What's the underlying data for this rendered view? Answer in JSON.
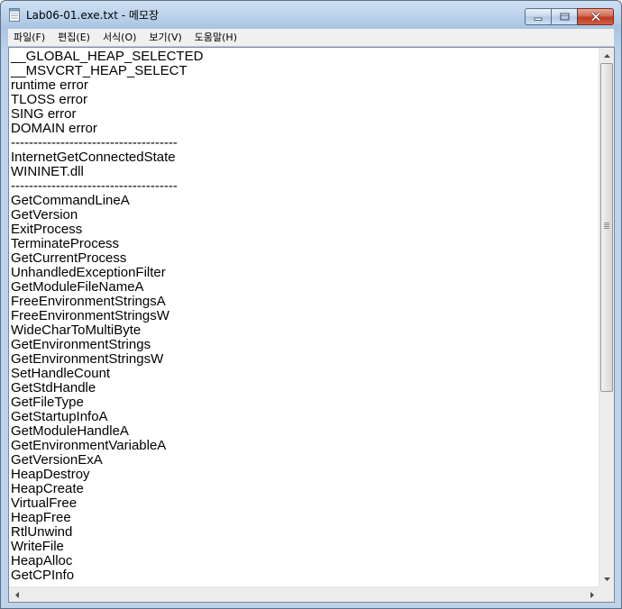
{
  "window": {
    "title": "Lab06-01.exe.txt - 메모장",
    "minimize_icon": "minimize-icon",
    "maximize_icon": "maximize-icon",
    "close_icon": "close-icon",
    "app_icon": "notepad-icon"
  },
  "menu": [
    {
      "label": "파일(F)"
    },
    {
      "label": "편집(E)"
    },
    {
      "label": "서식(O)"
    },
    {
      "label": "보기(V)"
    },
    {
      "label": "도움말(H)"
    }
  ],
  "content": {
    "lines": [
      "__GLOBAL_HEAP_SELECTED",
      "__MSVCRT_HEAP_SELECT",
      "runtime error",
      "TLOSS error",
      "SING error",
      "DOMAIN error",
      "-------------------------------------",
      "InternetGetConnectedState",
      "WININET.dll",
      "-------------------------------------",
      "GetCommandLineA",
      "GetVersion",
      "ExitProcess",
      "TerminateProcess",
      "GetCurrentProcess",
      "UnhandledExceptionFilter",
      "GetModuleFileNameA",
      "FreeEnvironmentStringsA",
      "FreeEnvironmentStringsW",
      "WideCharToMultiByte",
      "GetEnvironmentStrings",
      "GetEnvironmentStringsW",
      "SetHandleCount",
      "GetStdHandle",
      "GetFileType",
      "GetStartupInfoA",
      "GetModuleHandleA",
      "GetEnvironmentVariableA",
      "GetVersionExA",
      "HeapDestroy",
      "HeapCreate",
      "VirtualFree",
      "HeapFree",
      "RtlUnwind",
      "WriteFile",
      "HeapAlloc",
      "GetCPInfo"
    ]
  },
  "colors": {
    "title_bar": "#b9d1ea",
    "close_button": "#c0391f",
    "menu_bg": "#f0f0f0",
    "text": "#000000"
  }
}
